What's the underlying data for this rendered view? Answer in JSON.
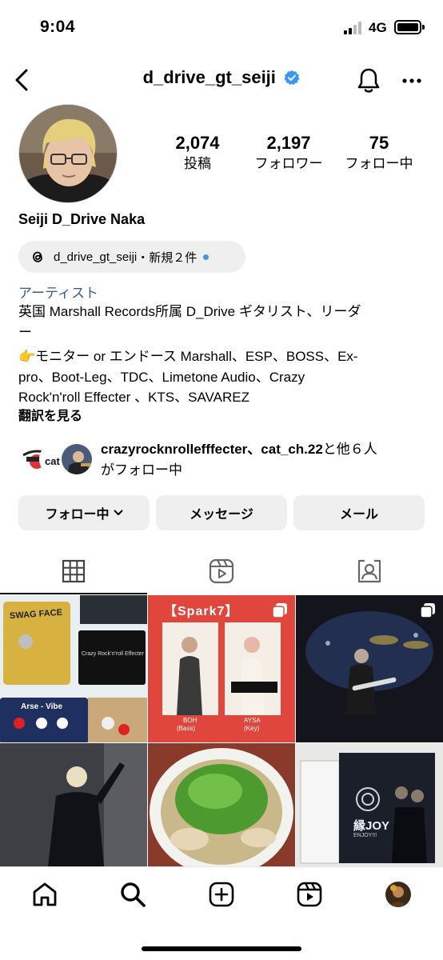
{
  "status_bar": {
    "time": "9:04",
    "network": "4G"
  },
  "header": {
    "username": "d_drive_gt_seiji"
  },
  "stats": [
    {
      "value": "2,074",
      "label": "投稿"
    },
    {
      "value": "2,197",
      "label": "フォロワー"
    },
    {
      "value": "75",
      "label": "フォロー中"
    }
  ],
  "profile": {
    "name": "Seiji D_Drive Naka",
    "threads": {
      "handle": "d_drive_gt_seiji",
      "new_label": "・新規２件"
    },
    "category": "アーティスト",
    "bio": [
      "英国 Marshall Records所属 D_Drive ギタリスト、リーダ",
      "ー",
      "👉モニター or エンドース Marshall、ESP、BOSS、Ex-",
      "pro、Boot-Leg、TDC、Limetone Audio、Crazy",
      "Rock'n'roll Effecter 、KTS、SAVAREZ"
    ],
    "translate_label": "翻訳を見る"
  },
  "followed_by": {
    "names": "crazyrocknrollefffecter、cat_ch.22",
    "suffix": "と他６人",
    "line2": "がフォロー中"
  },
  "actions": {
    "following_label": "フォロー中",
    "message_label": "メッセージ",
    "email_label": "メール"
  },
  "tabs": [
    {
      "icon": "grid-icon",
      "active": true
    },
    {
      "icon": "reels-icon",
      "active": false
    },
    {
      "icon": "tagged-icon",
      "active": false
    }
  ],
  "posts": [
    {
      "caption_lines": [
        "SWAG FACE",
        "Crazy Rock'n'roll Effecter",
        "Arse - Vibe"
      ],
      "multi": false
    },
    {
      "caption_lines": [
        "【Spark7】",
        "BOH",
        "(Bass)",
        "AYSA",
        "(Key)"
      ],
      "multi": true
    },
    {
      "caption_lines": [],
      "multi": true
    },
    {
      "caption_lines": [],
      "multi": false
    },
    {
      "caption_lines": [],
      "multi": false
    },
    {
      "caption_lines": [
        "縁JOY",
        "ENJOY!!!"
      ],
      "multi": false
    }
  ],
  "bottom_nav": [
    "home-icon",
    "search-icon",
    "create-icon",
    "reels-icon",
    "profile-avatar"
  ],
  "colors": {
    "verified": "#3897f0",
    "category_link": "#3a5a8c",
    "button_bg": "#efefef"
  }
}
